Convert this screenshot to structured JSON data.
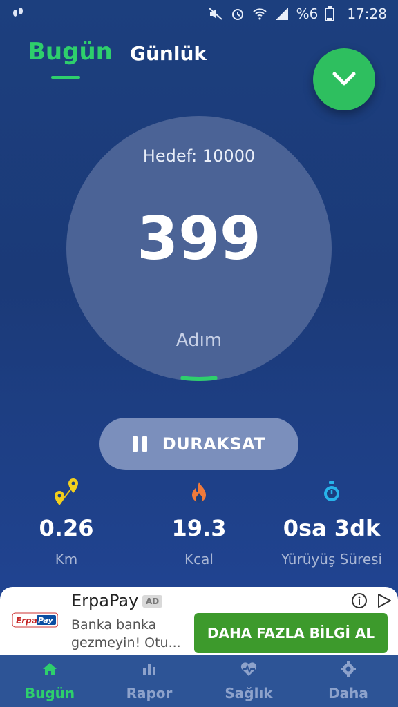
{
  "status_bar": {
    "battery_text": "%6",
    "time": "17:28"
  },
  "tabs": [
    {
      "label": "Bugün",
      "active": true
    },
    {
      "label": "Günlük",
      "active": false
    }
  ],
  "counter": {
    "goal_text": "Hedef: 10000",
    "steps": "399",
    "unit": "Adım",
    "progress_fraction": 0.04
  },
  "pause_button": {
    "label": "DURAKSAT"
  },
  "stats": [
    {
      "value": "0.26",
      "label": "Km",
      "icon": "location-pins-icon"
    },
    {
      "value": "19.3",
      "label": "Kcal",
      "icon": "flame-icon"
    },
    {
      "value": "0sa 3dk",
      "label": "Yürüyüş Süresi",
      "icon": "stopwatch-icon"
    }
  ],
  "ad": {
    "title": "ErpaPay",
    "badge": "AD",
    "description": "Banka banka gezmeyin! Otu...",
    "cta": "DAHA FAZLA BİLGİ AL",
    "logo_text": "ErpaPay"
  },
  "bottom_nav": [
    {
      "label": "Bugün",
      "icon": "home-icon",
      "active": true
    },
    {
      "label": "Rapor",
      "icon": "bar-chart-icon",
      "active": false
    },
    {
      "label": "Sağlık",
      "icon": "heart-pulse-icon",
      "active": false
    },
    {
      "label": "Daha",
      "icon": "gear-icon",
      "active": false
    }
  ],
  "colors": {
    "accent_green": "#2ecf6c",
    "background": "#1c3f7e",
    "ring": "#4b6396",
    "cta_green": "#3d9a2c"
  }
}
